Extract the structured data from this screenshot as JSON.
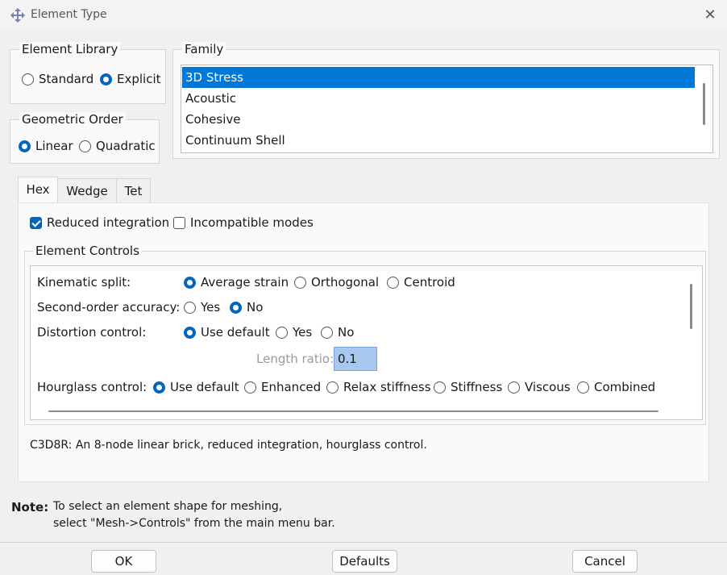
{
  "window": {
    "title": "Element Type"
  },
  "element_library": {
    "legend": "Element Library",
    "options": [
      "Standard",
      "Explicit"
    ],
    "selected": "Explicit"
  },
  "geometric_order": {
    "legend": "Geometric Order",
    "options": [
      "Linear",
      "Quadratic"
    ],
    "selected": "Linear"
  },
  "family": {
    "legend": "Family",
    "items": [
      "3D Stress",
      "Acoustic",
      "Cohesive",
      "Continuum Shell"
    ],
    "selected": "3D Stress"
  },
  "tabs": [
    {
      "label": "Hex",
      "active": true
    },
    {
      "label": "Wedge",
      "active": false
    },
    {
      "label": "Tet",
      "active": false
    }
  ],
  "options": {
    "reduced_integration": {
      "label": "Reduced integration",
      "checked": true
    },
    "incompatible_modes": {
      "label": "Incompatible modes",
      "checked": false
    }
  },
  "element_controls": {
    "legend": "Element Controls",
    "kinematic_split": {
      "label": "Kinematic split:",
      "options": [
        "Average strain",
        "Orthogonal",
        "Centroid"
      ],
      "selected": "Average strain"
    },
    "second_order_accuracy": {
      "label": "Second-order accuracy:",
      "options": [
        "Yes",
        "No"
      ],
      "selected": "No"
    },
    "distortion_control": {
      "label": "Distortion control:",
      "options": [
        "Use default",
        "Yes",
        "No"
      ],
      "selected": "Use default"
    },
    "length_ratio": {
      "label": "Length ratio:",
      "value": "0.1"
    },
    "hourglass_control": {
      "label": "Hourglass control:",
      "options": [
        "Use default",
        "Enhanced",
        "Relax stiffness",
        "Stiffness",
        "Viscous",
        "Combined"
      ],
      "selected": "Use default"
    }
  },
  "description": "C3D8R:  An 8-node linear brick, reduced integration, hourglass control.",
  "note": {
    "label": "Note:",
    "line1": "To select an element shape for meshing,",
    "line2": "select \"Mesh->Controls\" from the main menu bar."
  },
  "buttons": {
    "ok": "OK",
    "defaults": "Defaults",
    "cancel": "Cancel"
  },
  "colors": {
    "accent": "#0067c0",
    "selection": "#0078d7",
    "input_highlight": "#a8c8f0"
  }
}
